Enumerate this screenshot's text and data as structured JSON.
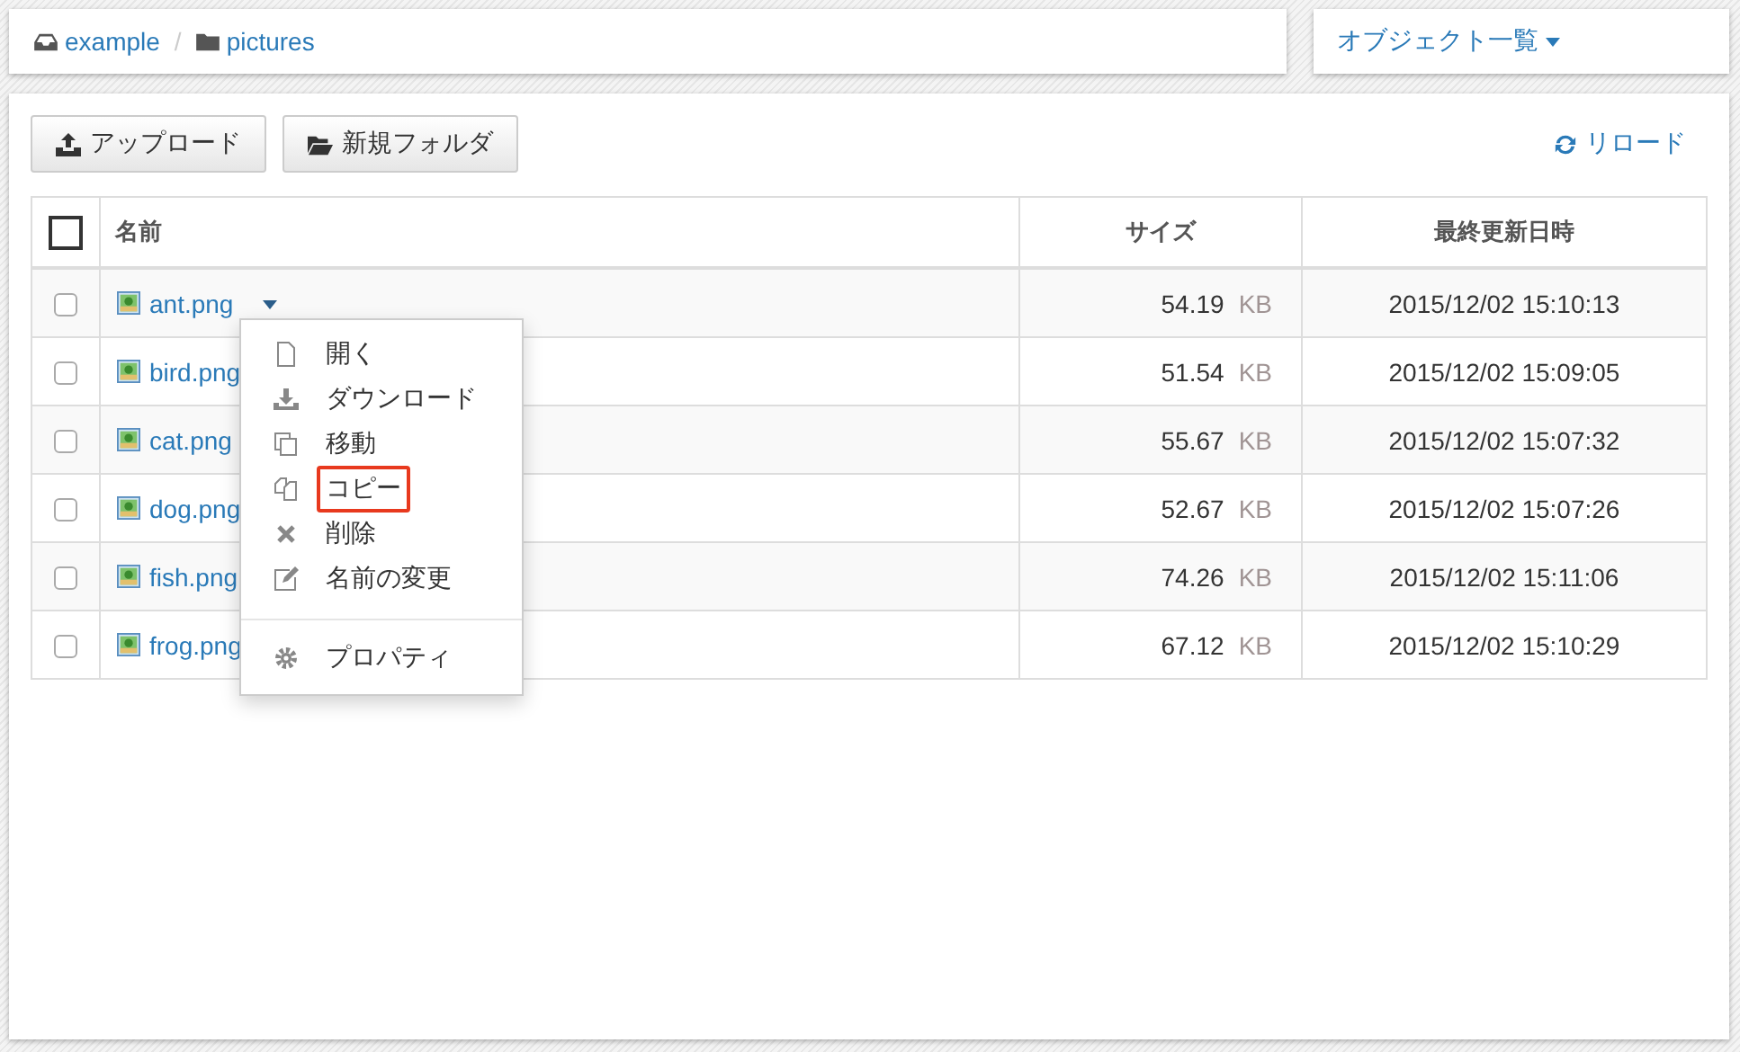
{
  "breadcrumb": [
    {
      "label": "example",
      "kind": "drive"
    },
    {
      "label": "pictures",
      "kind": "folder",
      "separator": "/"
    }
  ],
  "view_menu": {
    "label": "オブジェクト一覧"
  },
  "toolbar": {
    "upload": "アップロード",
    "new_folder": "新規フォルダ",
    "reload": "リロード"
  },
  "table": {
    "all_checked": false,
    "columns": [
      "名前",
      "サイズ",
      "最終更新日時"
    ],
    "rows": [
      {
        "name": "ant.png",
        "size": "54.19",
        "unit": "KB",
        "modified": "2015/12/02 15:10:13",
        "checked": false,
        "menu_open": true
      },
      {
        "name": "bird.png",
        "size": "51.54",
        "unit": "KB",
        "modified": "2015/12/02 15:09:05",
        "checked": false,
        "menu_open": false
      },
      {
        "name": "cat.png",
        "size": "55.67",
        "unit": "KB",
        "modified": "2015/12/02 15:07:32",
        "checked": false,
        "menu_open": false
      },
      {
        "name": "dog.png",
        "size": "52.67",
        "unit": "KB",
        "modified": "2015/12/02 15:07:26",
        "checked": false,
        "menu_open": false
      },
      {
        "name": "fish.png",
        "size": "74.26",
        "unit": "KB",
        "modified": "2015/12/02 15:11:06",
        "checked": false,
        "menu_open": false
      },
      {
        "name": "frog.png",
        "size": "67.12",
        "unit": "KB",
        "modified": "2015/12/02 15:10:29",
        "checked": false,
        "menu_open": false
      }
    ]
  },
  "context_menu": {
    "groups": [
      [
        {
          "label": "開く",
          "highlighted": false
        },
        {
          "label": "ダウンロード",
          "highlighted": false
        },
        {
          "label": "移動",
          "highlighted": false
        },
        {
          "label": "コピー",
          "highlighted": true
        },
        {
          "label": "削除",
          "highlighted": false
        },
        {
          "label": "名前の変更",
          "highlighted": false
        }
      ],
      [
        {
          "label": "プロパティ",
          "highlighted": false
        }
      ]
    ]
  }
}
